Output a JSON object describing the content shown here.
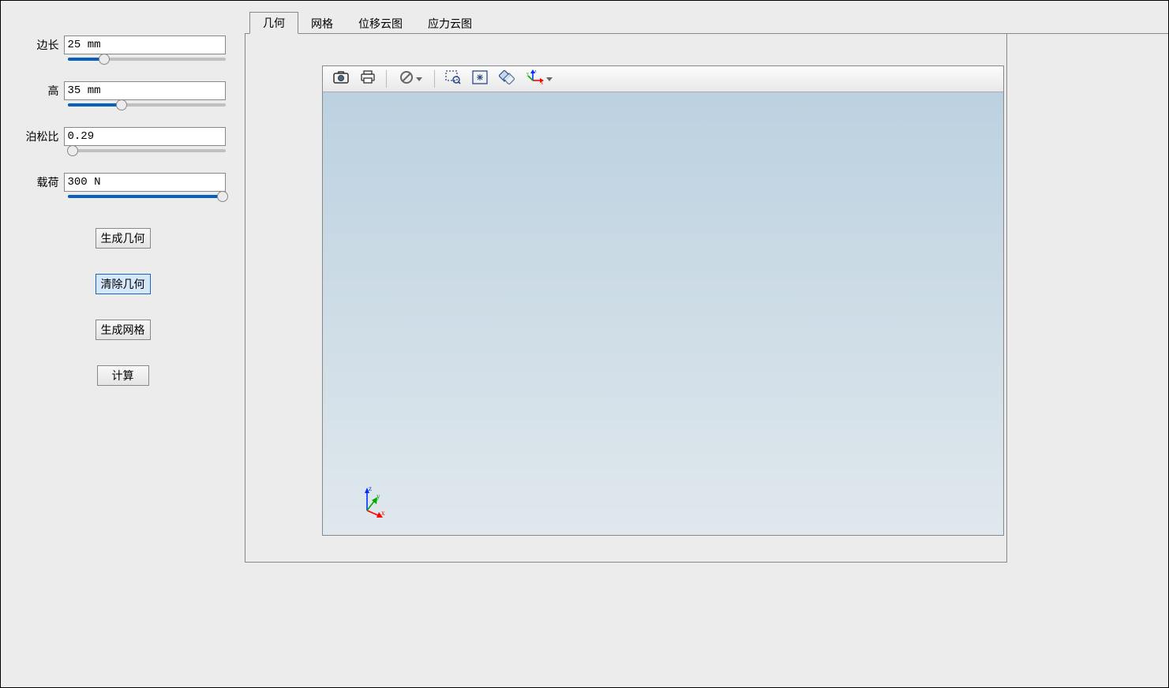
{
  "sidebar": {
    "params": [
      {
        "label": "边长",
        "value": "25 mm",
        "slider_percent": 23
      },
      {
        "label": "高",
        "value": "35 mm",
        "slider_percent": 34
      },
      {
        "label": "泊松比",
        "value": "0.29",
        "slider_percent": 3
      },
      {
        "label": "载荷",
        "value": "300 N",
        "slider_percent": 98
      }
    ],
    "buttons": {
      "generate_geometry": "生成几何",
      "clear_geometry": "清除几何",
      "generate_mesh": "生成网格",
      "compute": "计算"
    }
  },
  "tabs": [
    {
      "label": "几何",
      "active": true
    },
    {
      "label": "网格",
      "active": false
    },
    {
      "label": "位移云图",
      "active": false
    },
    {
      "label": "应力云图",
      "active": false
    }
  ],
  "viewport": {
    "axis_labels": {
      "x": "x",
      "y": "y",
      "z": "z"
    }
  }
}
